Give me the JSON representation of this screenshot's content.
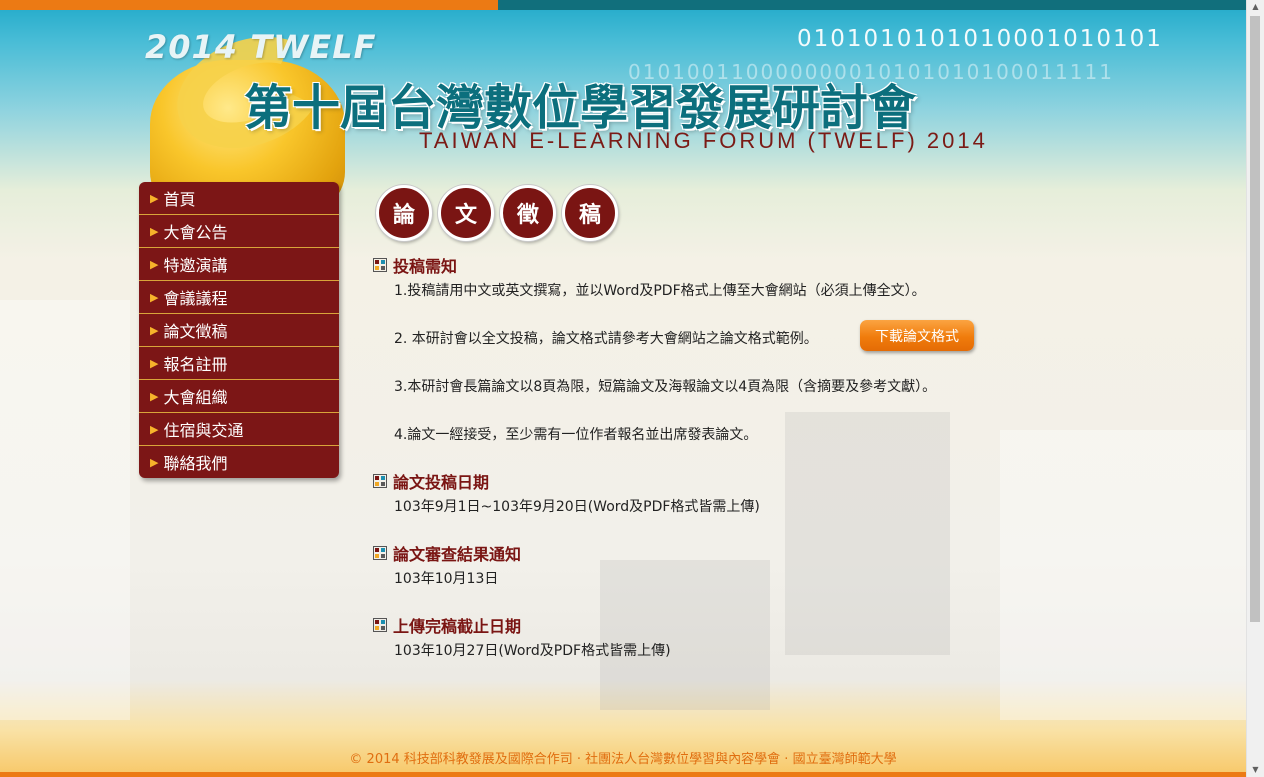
{
  "header": {
    "brand_year": "2014 TWELF",
    "binary_line1": "0101010101010001010101",
    "binary_line2": "010100110000000010101010100011111",
    "title_zh": "第十屆台灣數位學習發展研討會",
    "title_en": "TAIWAN E-LEARNING FORUM (TWELF) 2014"
  },
  "sidebar": {
    "items": [
      {
        "label": "首頁"
      },
      {
        "label": "大會公告"
      },
      {
        "label": "特邀演講"
      },
      {
        "label": "會議議程"
      },
      {
        "label": "論文徵稿"
      },
      {
        "label": "報名註冊"
      },
      {
        "label": "大會組織"
      },
      {
        "label": "住宿與交通"
      },
      {
        "label": "聯絡我們"
      }
    ],
    "arrow": "▶"
  },
  "page_heading": {
    "chars": [
      "論",
      "文",
      "徵",
      "稿"
    ]
  },
  "sections": {
    "guidelines": {
      "title": "投稿需知",
      "items": [
        "1.投稿請用中文或英文撰寫，並以Word及PDF格式上傳至大會網站（必須上傳全文）。",
        "2. 本研討會以全文投稿，論文格式請參考大會網站之論文格式範例。",
        "3.本研討會長篇論文以8頁為限，短篇論文及海報論文以4頁為限（含摘要及參考文獻）。",
        "4.論文一經接受，至少需有一位作者報名並出席發表論文。"
      ],
      "download_label": "下載論文格式"
    },
    "submission": {
      "title": "論文投稿日期",
      "text": "103年9月1日~103年9月20日(Word及PDF格式皆需上傳)"
    },
    "review": {
      "title": "論文審查結果通知",
      "text": "103年10月13日"
    },
    "final": {
      "title": "上傳完稿截止日期",
      "text": "103年10月27日(Word及PDF格式皆需上傳)"
    }
  },
  "footer": {
    "text": "© 2014 科技部科教發展及國際合作司 · 社團法人台灣數位學習與內容學會 · 國立臺灣師範大學"
  },
  "colors": {
    "accent": "#7a1513",
    "topbar_left": "#ec7a14",
    "topbar_right": "#116f7c",
    "button": "#f07c0c"
  }
}
